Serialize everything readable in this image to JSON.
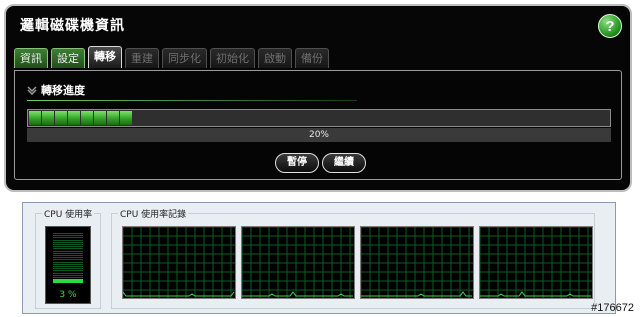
{
  "dialog": {
    "title": "邏輯磁碟機資訊",
    "help_glyph": "?"
  },
  "tabs": [
    {
      "label": "資訊",
      "state": "normal"
    },
    {
      "label": "設定",
      "state": "normal"
    },
    {
      "label": "轉移",
      "state": "active"
    },
    {
      "label": "重建",
      "state": "disabled"
    },
    {
      "label": "同步化",
      "state": "disabled"
    },
    {
      "label": "初始化",
      "state": "disabled"
    },
    {
      "label": "啟動",
      "state": "disabled"
    },
    {
      "label": "備份",
      "state": "disabled"
    }
  ],
  "migration": {
    "section_title": "轉移進度",
    "progress_percent": 20,
    "progress_label": "20%",
    "pause_label": "暫停",
    "continue_label": "繼續"
  },
  "cpu": {
    "usage_group_label": "CPU 使用率",
    "history_group_label": "CPU 使用率記錄",
    "usage_text": "3 %",
    "usage_percent": 3,
    "graph_count": 4
  },
  "watermark": "#176672",
  "colors": {
    "progress_green": "#2f9b22",
    "graph_grid": "#0b5e24",
    "graph_line": "#38d84a"
  }
}
